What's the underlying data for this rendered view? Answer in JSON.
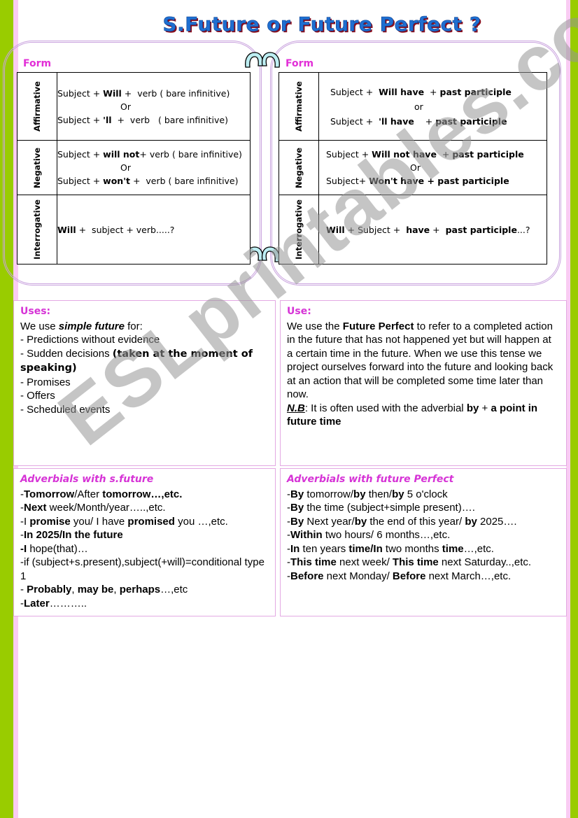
{
  "title": "S.Future or Future Perfect ?",
  "left_panel": {
    "form_label": "Form",
    "rows": [
      {
        "label": "Affirmative",
        "lines": [
          {
            "parts": [
              [
                "Subject + ",
                false
              ],
              [
                "Will",
                true
              ],
              [
                " +  verb ( bare infinitive)",
                false
              ]
            ]
          },
          {
            "parts": [
              [
                "Or",
                false
              ]
            ],
            "or": true
          },
          {
            "parts": [
              [
                "Subject + ",
                false
              ],
              [
                "'ll",
                true
              ],
              [
                "  +  verb   ( bare infinitive)",
                false
              ]
            ]
          }
        ]
      },
      {
        "label": "Negative",
        "lines": [
          {
            "parts": [
              [
                "Subject + ",
                false
              ],
              [
                "will not",
                true
              ],
              [
                "+ verb ( bare infinitive)",
                false
              ]
            ]
          },
          {
            "parts": [
              [
                "Or",
                false
              ]
            ],
            "or": true
          },
          {
            "parts": [
              [
                "Subject + ",
                false
              ],
              [
                "won't",
                true
              ],
              [
                " +  verb ( bare infinitive)",
                false
              ]
            ]
          }
        ]
      },
      {
        "label": "Interrogative",
        "lines": [
          {
            "parts": [
              [
                "Will",
                true
              ],
              [
                " +  subject + verb.....?",
                false
              ]
            ]
          }
        ]
      }
    ]
  },
  "right_panel": {
    "form_label": "Form",
    "rows": [
      {
        "label": "Affirmative",
        "lines": [
          {
            "parts": [
              [
                "Subject +  ",
                false
              ],
              [
                "Will have",
                true
              ],
              [
                "  + ",
                false
              ],
              [
                "past participle",
                true
              ]
            ]
          },
          {
            "parts": [
              [
                "or",
                false
              ]
            ],
            "or": true
          },
          {
            "parts": [
              [
                "Subject +  ",
                false
              ],
              [
                "'ll have",
                true
              ],
              [
                "    + ",
                false
              ],
              [
                "past participle",
                true
              ]
            ]
          }
        ]
      },
      {
        "label": "Negative",
        "lines": [
          {
            "parts": [
              [
                "Subject + ",
                false
              ],
              [
                "Will not have",
                true
              ],
              [
                "  + ",
                false
              ],
              [
                "past participle",
                true
              ]
            ]
          },
          {
            "parts": [
              [
                "Or",
                false
              ]
            ],
            "or": true
          },
          {
            "parts": [
              [
                "Subject+ ",
                false
              ],
              [
                "Won't have + past participle",
                true
              ]
            ]
          }
        ]
      },
      {
        "label": "Interrogative",
        "lines": [
          {
            "parts": [
              [
                "Will",
                true
              ],
              [
                " + Subject +  ",
                false
              ],
              [
                "have",
                true
              ],
              [
                " +  ",
                false
              ],
              [
                "past participle",
                true
              ],
              [
                "...?",
                false
              ]
            ]
          }
        ]
      }
    ]
  },
  "uses_simple": {
    "heading": "Uses:",
    "intro": [
      [
        "We use ",
        "n"
      ],
      [
        "simple future",
        "bi"
      ],
      [
        " for:",
        "n"
      ]
    ],
    "items": [
      [
        [
          " - Predictions without evidence",
          "n"
        ]
      ],
      [
        [
          " - Sudden decisions ",
          "n"
        ],
        [
          "(taken at the moment of speaking)",
          "c"
        ]
      ],
      [
        [
          " - Promises",
          "n"
        ]
      ],
      [
        [
          " - Offers",
          "n"
        ]
      ],
      [
        [
          " - Scheduled events",
          "n"
        ]
      ]
    ]
  },
  "uses_perfect": {
    "heading": "Use:",
    "paragraph": [
      [
        "We use the ",
        "n"
      ],
      [
        "Future Perfect",
        "b"
      ],
      [
        " to refer to a completed action in the future that has not happened yet but will happen at a certain  time in the future. When we use this tense we project ourselves forward into the future and looking back at an action that will be completed some time later than now.",
        "n"
      ]
    ],
    "note": [
      [
        " ",
        "n"
      ],
      [
        "N.B",
        "u"
      ],
      [
        ": It is often used with the adverbial ",
        "n"
      ],
      [
        "by",
        "b"
      ],
      [
        " + ",
        "n"
      ],
      [
        "a point in future time",
        "b"
      ]
    ]
  },
  "adverbials_simple": {
    "heading": "Adverbials with s.future",
    "items": [
      [
        [
          "-",
          "n"
        ],
        [
          "Tomorrow",
          "b"
        ],
        [
          "/After ",
          "n"
        ],
        [
          "tomorrow…,etc.",
          "b"
        ]
      ],
      [
        [
          "-",
          "n"
        ],
        [
          "Next",
          "b"
        ],
        [
          "  week/Month/year…..,etc.",
          "n"
        ]
      ],
      [
        [
          "-I ",
          "n"
        ],
        [
          "promise",
          "b"
        ],
        [
          " you/ I have ",
          "n"
        ],
        [
          "promised",
          "b"
        ],
        [
          " you …,etc.",
          "n"
        ]
      ],
      [
        [
          "-",
          "n"
        ],
        [
          "In 2025/In the future",
          "b"
        ]
      ],
      [
        [
          "-I",
          "b"
        ],
        [
          " hope(that)…",
          "n"
        ]
      ],
      [
        [
          "-if (subject+s.present),subject(+will)=conditional type 1",
          "n"
        ]
      ],
      [
        [
          "- ",
          "n"
        ],
        [
          "Probably",
          "b"
        ],
        [
          ", ",
          "n"
        ],
        [
          "may be",
          "b"
        ],
        [
          ", ",
          "n"
        ],
        [
          "perhaps",
          "b"
        ],
        [
          "…,etc",
          "n"
        ]
      ],
      [
        [
          "-",
          "n"
        ],
        [
          "Later",
          "b"
        ],
        [
          "………..",
          "n"
        ]
      ]
    ]
  },
  "adverbials_perfect": {
    "heading": "Adverbials with future Perfect",
    "items": [
      [
        [
          "-",
          "n"
        ],
        [
          "By",
          "b"
        ],
        [
          "  tomorrow/",
          "n"
        ],
        [
          "by",
          "b"
        ],
        [
          " then/",
          "n"
        ],
        [
          "by",
          "b"
        ],
        [
          " 5 o'clock",
          "n"
        ]
      ],
      [
        [
          "-",
          "n"
        ],
        [
          "By",
          "b"
        ],
        [
          " the time (subject+simple present)….",
          "n"
        ]
      ],
      [
        [
          "-",
          "n"
        ],
        [
          "By",
          "b"
        ],
        [
          " Next year/",
          "n"
        ],
        [
          "by",
          "b"
        ],
        [
          " the end of this year/ ",
          "n"
        ],
        [
          "by",
          "b"
        ],
        [
          " 2025….",
          "n"
        ]
      ],
      [
        [
          "-",
          "n"
        ],
        [
          "Within",
          "b"
        ],
        [
          " two hours/ 6 months…,etc.",
          "n"
        ]
      ],
      [
        [
          "-",
          "n"
        ],
        [
          "In",
          "b"
        ],
        [
          " ten years ",
          "n"
        ],
        [
          "time/In",
          "b"
        ],
        [
          " two months ",
          "n"
        ],
        [
          "time",
          "b"
        ],
        [
          "…,etc.",
          "n"
        ]
      ],
      [
        [
          "-",
          "n"
        ],
        [
          "This time",
          "b"
        ],
        [
          " next week/ ",
          "n"
        ],
        [
          "This time",
          "b"
        ],
        [
          " next Saturday..,etc.",
          "n"
        ]
      ],
      [
        [
          "-",
          "n"
        ],
        [
          "Before",
          "b"
        ],
        [
          " next Monday/ ",
          "n"
        ],
        [
          "Before",
          "b"
        ],
        [
          " next March…,etc.",
          "n"
        ]
      ]
    ]
  },
  "watermark": "ESLprintables.com",
  "colors": {
    "border_green": "#99cc00",
    "border_pink": "#f9ccf2",
    "heading_magenta": "#d633d6",
    "title_blue": "#1f6fd1",
    "frame_lilac": "#c9a3de",
    "link_cyan": "#bdeef2"
  }
}
